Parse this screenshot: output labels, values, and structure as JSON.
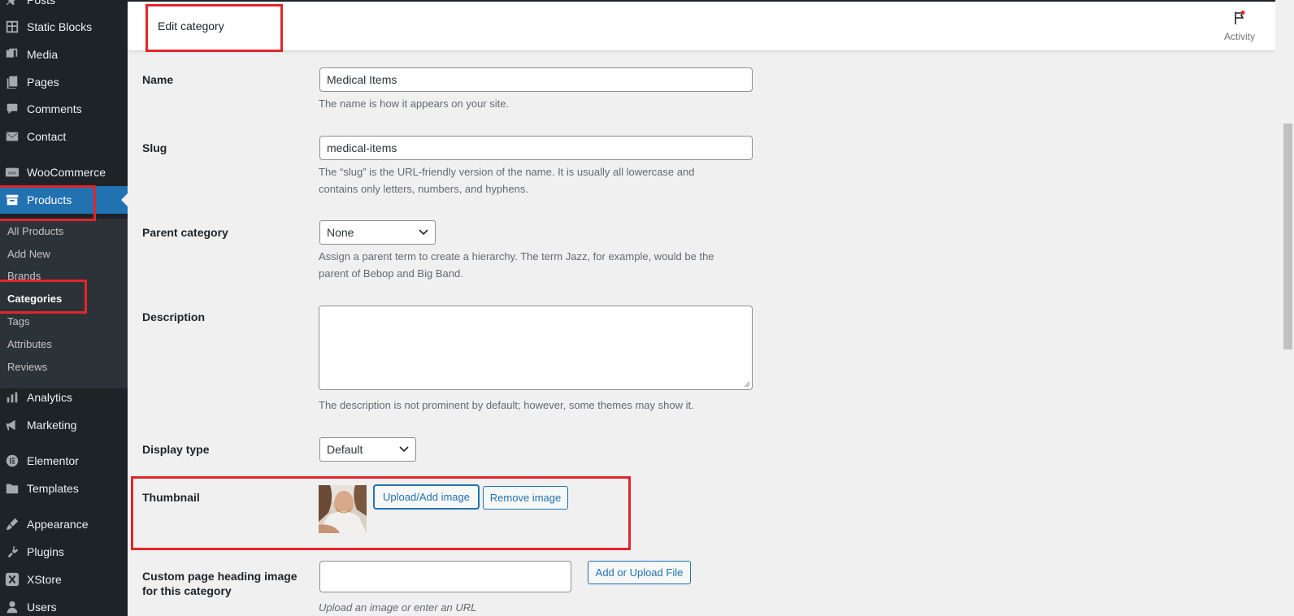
{
  "sidebar": {
    "items": [
      {
        "key": "posts",
        "label": "Posts",
        "icon": "pin-icon"
      },
      {
        "key": "static-blocks",
        "label": "Static Blocks",
        "icon": "blocks-icon"
      },
      {
        "key": "media",
        "label": "Media",
        "icon": "media-icon"
      },
      {
        "key": "pages",
        "label": "Pages",
        "icon": "pages-icon"
      },
      {
        "key": "comments",
        "label": "Comments",
        "icon": "comment-icon"
      },
      {
        "key": "contact",
        "label": "Contact",
        "icon": "mail-icon"
      },
      {
        "key": "woocommerce",
        "label": "WooCommerce",
        "icon": "woo-icon"
      },
      {
        "key": "products",
        "label": "Products",
        "icon": "archive-icon"
      },
      {
        "key": "analytics",
        "label": "Analytics",
        "icon": "chart-icon"
      },
      {
        "key": "marketing",
        "label": "Marketing",
        "icon": "megaphone-icon"
      },
      {
        "key": "elementor",
        "label": "Elementor",
        "icon": "elementor-icon"
      },
      {
        "key": "templates",
        "label": "Templates",
        "icon": "folder-icon"
      },
      {
        "key": "appearance",
        "label": "Appearance",
        "icon": "brush-icon"
      },
      {
        "key": "plugins",
        "label": "Plugins",
        "icon": "plug-icon"
      },
      {
        "key": "xstore",
        "label": "XStore",
        "icon": "xstore-icon"
      },
      {
        "key": "users",
        "label": "Users",
        "icon": "user-icon"
      }
    ],
    "submenu": [
      {
        "label": "All Products"
      },
      {
        "label": "Add New"
      },
      {
        "label": "Brands"
      },
      {
        "label": "Categories"
      },
      {
        "label": "Tags"
      },
      {
        "label": "Attributes"
      },
      {
        "label": "Reviews"
      }
    ]
  },
  "header": {
    "title": "Edit category",
    "activity_label": "Activity"
  },
  "form": {
    "name": {
      "label": "Name",
      "value": "Medical Items",
      "help": "The name is how it appears on your site."
    },
    "slug": {
      "label": "Slug",
      "value": "medical-items",
      "help_line1": "The “slug” is the URL-friendly version of the name. It is usually all lowercase and",
      "help_line2": "contains only letters, numbers, and hyphens."
    },
    "parent": {
      "label": "Parent category",
      "selected": "None",
      "help_line1": "Assign a parent term to create a hierarchy. The term Jazz, for example, would be the",
      "help_line2": "parent of Bebop and Big Band."
    },
    "description": {
      "label": "Description",
      "value": "",
      "help": "The description is not prominent by default; however, some themes may show it."
    },
    "display_type": {
      "label": "Display type",
      "selected": "Default"
    },
    "thumbnail": {
      "label": "Thumbnail",
      "upload_button": "Upload/Add image",
      "remove_button": "Remove image"
    },
    "heading_image": {
      "label_line1": "Custom page heading image",
      "label_line2": "for this category",
      "value": "",
      "upload_button": "Add or Upload File",
      "help": "Upload an image or enter an URL"
    }
  },
  "colors": {
    "accent": "#2271b1",
    "sidebar_bg": "#1d2327",
    "highlight": "#e3252b"
  }
}
